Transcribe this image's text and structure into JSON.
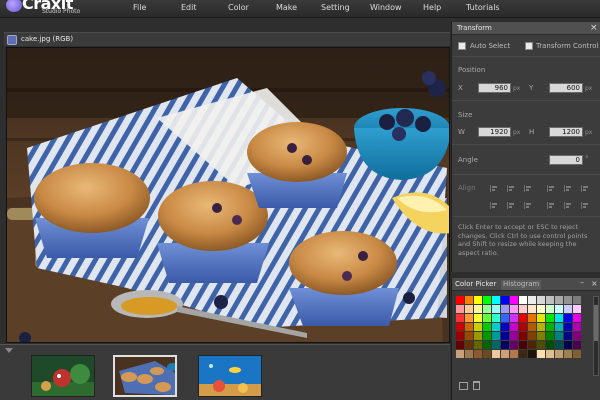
{
  "app": {
    "logo_text": "Craxit",
    "logo_sub": "Studio Photo"
  },
  "menu": {
    "items": [
      "File",
      "Edit",
      "Color",
      "Make",
      "Setting",
      "Window",
      "Help",
      "Tutorials"
    ]
  },
  "document": {
    "title": "cake.jpg (RGB)"
  },
  "thumbnails": [
    {
      "name": "forest-thumb",
      "selected": false
    },
    {
      "name": "cake-thumb",
      "selected": true
    },
    {
      "name": "underwater-thumb",
      "selected": false
    }
  ],
  "transform": {
    "title": "Transform",
    "close_glyph": "×",
    "auto_select": "Auto Select",
    "transform_controls": "Transform Controls",
    "position_label": "Position",
    "x_label": "X",
    "x_value": "960",
    "y_label": "Y",
    "y_value": "600",
    "size_label": "Size",
    "w_label": "W",
    "w_value": "1920",
    "h_label": "H",
    "h_value": "1200",
    "unit": "px",
    "angle_label": "Angle",
    "angle_value": "0",
    "angle_unit": "°",
    "align_label": "Align",
    "help_text": "Click Enter to accept or ESC to reject changes. Click Ctrl to use control points and Shift to resize while keeping the aspect ratio."
  },
  "color_picker": {
    "tab_picker": "Color Picker",
    "tab_histogram": "Histogram",
    "min_glyph": "–",
    "close_glyph": "×",
    "swatches": [
      "#ff0000",
      "#ff8000",
      "#ffff00",
      "#00ff00",
      "#00ffff",
      "#0000ff",
      "#ff00ff",
      "#ffffff",
      "#ececec",
      "#d6d6d6",
      "#bfbfbf",
      "#a9a9a9",
      "#929292",
      "#7c7c7c",
      "#ff9999",
      "#ffcc99",
      "#ffff99",
      "#99ff99",
      "#99ffff",
      "#9999ff",
      "#ff99ff",
      "#ffcccc",
      "#ffe5cc",
      "#ffffcc",
      "#ccffcc",
      "#ccffff",
      "#ccccff",
      "#ffccff",
      "#ff3333",
      "#ff9933",
      "#ffff33",
      "#66ff33",
      "#33ffcc",
      "#3366ff",
      "#cc33ff",
      "#e60000",
      "#e67300",
      "#e6e600",
      "#00e600",
      "#00e6e6",
      "#0000e6",
      "#e600e6",
      "#cc0000",
      "#cc6600",
      "#cccc00",
      "#00cc00",
      "#00cccc",
      "#0000cc",
      "#cc00cc",
      "#b30000",
      "#b35900",
      "#b3b300",
      "#00b300",
      "#00b3b3",
      "#0000b3",
      "#b300b3",
      "#990000",
      "#994c00",
      "#999900",
      "#009900",
      "#009999",
      "#000099",
      "#990099",
      "#800000",
      "#804000",
      "#808000",
      "#008000",
      "#008080",
      "#000080",
      "#800080",
      "#660000",
      "#663300",
      "#666600",
      "#006600",
      "#006666",
      "#000066",
      "#660066",
      "#4d0000",
      "#4d2600",
      "#4d4d00",
      "#004d00",
      "#004d4d",
      "#00004d",
      "#4d004d",
      "#c8a07a",
      "#a0784f",
      "#8c5a32",
      "#6e4620",
      "#f0c8a0",
      "#d2a078",
      "#b47850",
      "#3c2814",
      "#1e140a",
      "#ffe0b0",
      "#e0c090",
      "#c0a070",
      "#a08050",
      "#806030"
    ]
  }
}
